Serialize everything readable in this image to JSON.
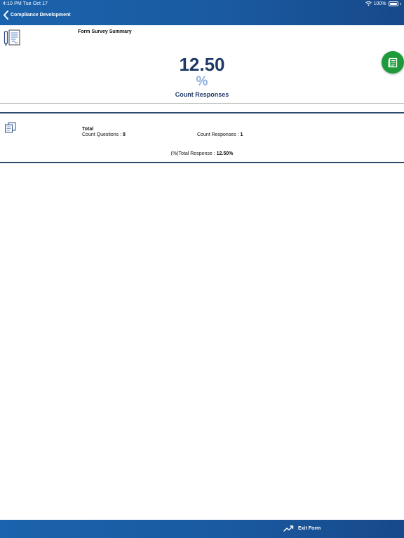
{
  "status_bar": {
    "time": "4:10 PM   Tue Oct 17",
    "battery": "100%"
  },
  "nav": {
    "back_label": "Compliance Development"
  },
  "summary": {
    "title": "Form Survey Summary",
    "value": "12.50",
    "unit": "%",
    "caption": "Count Responses"
  },
  "totals": {
    "label": "Total",
    "questions_label": "Count Questions : ",
    "questions_value": "8",
    "responses_label": "Count Responses : ",
    "responses_value": "1",
    "total_response_label": "(%)Total Response : ",
    "total_response_value": "12.50%"
  },
  "bottom_bar": {
    "exit_label": "Exit Form"
  },
  "colors": {
    "bar_blue": "#1a5aa1",
    "value_navy": "#1f3a66",
    "percent_light_blue": "#8fb0dc",
    "fab_green": "#1d9a3a"
  },
  "icons": {
    "form": "form-document-icon",
    "fab": "report-icon",
    "copy": "copy-documents-icon",
    "exit": "trend-up-icon"
  }
}
